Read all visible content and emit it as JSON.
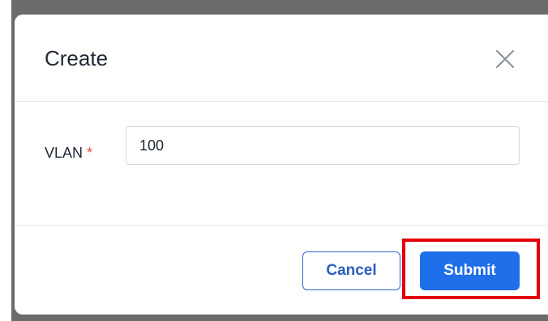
{
  "dialog": {
    "title": "Create",
    "close_icon": "close-icon"
  },
  "form": {
    "vlan": {
      "label": "VLAN",
      "required_mark": "*",
      "value": "100"
    }
  },
  "footer": {
    "cancel_label": "Cancel",
    "submit_label": "Submit"
  },
  "annotation": {
    "highlight_color": "#e3000b",
    "highlight_target": "submit-button"
  },
  "colors": {
    "primary": "#1f6fea",
    "required": "#e5484d",
    "overlay": "#6b6b6b"
  }
}
